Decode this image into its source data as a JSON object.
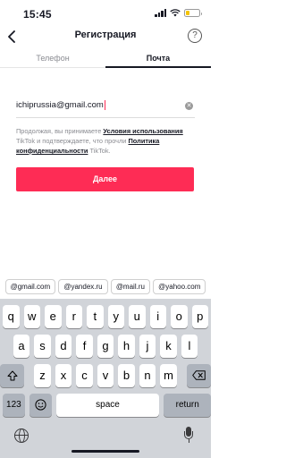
{
  "status_bar": {
    "time": "15:45",
    "battery_level": 0.3,
    "battery_color": "#f5c400"
  },
  "header": {
    "back_icon": "chevron-left-icon",
    "title": "Регистрация",
    "help_icon": "question-circle-icon"
  },
  "tabs": [
    {
      "label": "Телефон",
      "active": false
    },
    {
      "label": "Почта",
      "active": true
    }
  ],
  "email": {
    "value": "ichiprussia@gmail.com",
    "clear_icon": "clear-icon"
  },
  "terms": {
    "part1": "Продолжая, вы принимаете ",
    "link1": "Условия использования",
    "part2": " TikTok и подтверждаете, что прочли ",
    "link2": "Политика конфиденциальности",
    "part3": " TikTok."
  },
  "next_button": {
    "label": "Далее",
    "color": "#fe2c55"
  },
  "suggestions": [
    "@gmail.com",
    "@yandex.ru",
    "@mail.ru",
    "@yahoo.com"
  ],
  "keyboard": {
    "row1": [
      "q",
      "w",
      "e",
      "r",
      "t",
      "y",
      "u",
      "i",
      "o",
      "p"
    ],
    "row2": [
      "a",
      "s",
      "d",
      "f",
      "g",
      "h",
      "j",
      "k",
      "l"
    ],
    "row3": [
      "z",
      "x",
      "c",
      "v",
      "b",
      "n",
      "m"
    ],
    "shift_icon": "shift-icon",
    "delete_icon": "backspace-icon",
    "numbers_label": "123",
    "emoji_icon": "emoji-icon",
    "space_label": "space",
    "return_label": "return",
    "globe_icon": "globe-icon",
    "mic_icon": "microphone-icon"
  }
}
